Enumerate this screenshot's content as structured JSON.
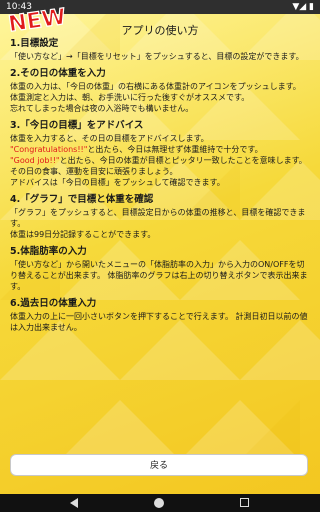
{
  "status": {
    "time": "10:43",
    "icons": "▼◢ ▮"
  },
  "badge": {
    "text": "NEW"
  },
  "title": "アプリの使い方",
  "sections": [
    {
      "heading": "1.目標設定",
      "lines": [
        "「使い方など」→「目標をリセット」をプッシュすると、目標の設定ができます。"
      ]
    },
    {
      "heading": "2.その日の体重を入力",
      "lines": [
        "体重の入力は、「今日の体重」の右横にある体重計のアイコンをプッシュします。",
        "体重測定と入力は、朝、お手洗いに行った後すぐがオススメです。",
        "忘れてしまった場合は夜の入浴時でも構いません。"
      ]
    },
    {
      "heading": "3.「今日の目標」をアドバイス",
      "line1": "体重を入力すると、その日の目標をアドバイスします。",
      "red1": "\"Congratulations!!\"",
      "line2_rest": "と出たら、今日は無理せず体重維持で十分です。",
      "red2": "\"Good job!!\"",
      "line3_rest": "と出たら、今日の体重が目標とピッタリ一致したことを意味します。",
      "line4": "その日の食事、運動を目安に頑張りましょう。",
      "line5": "アドバイスは「今日の目標」をプッシュして確認できます。"
    },
    {
      "heading": "4.「グラフ」で目標と体重を確認",
      "lines": [
        "「グラフ」をプッシュすると、目標設定日からの体重の推移と、目標を確認できます。",
        "体重は99日分記録することができます。"
      ]
    },
    {
      "heading": "5.体脂肪率の入力",
      "lines": [
        "「使い方など」から開いたメニューの「体脂肪率の入力」から入力のON/OFFを切り替えることが出来ます。 体脂肪率のグラフは右上の切り替えボタンで表示出来ます。"
      ]
    },
    {
      "heading": "6.過去日の体重入力",
      "lines": [
        "体重入力の上に一回小さいボタンを押下することで行えます。 計測日初日以前の値は入力出来ません。"
      ]
    }
  ],
  "back_button": "戻る",
  "colors": {
    "bg_light": "#fff7a0",
    "bg_dark": "#f3c61f",
    "badge_red": "#e01b1b",
    "highlight": "#e01b1b"
  }
}
